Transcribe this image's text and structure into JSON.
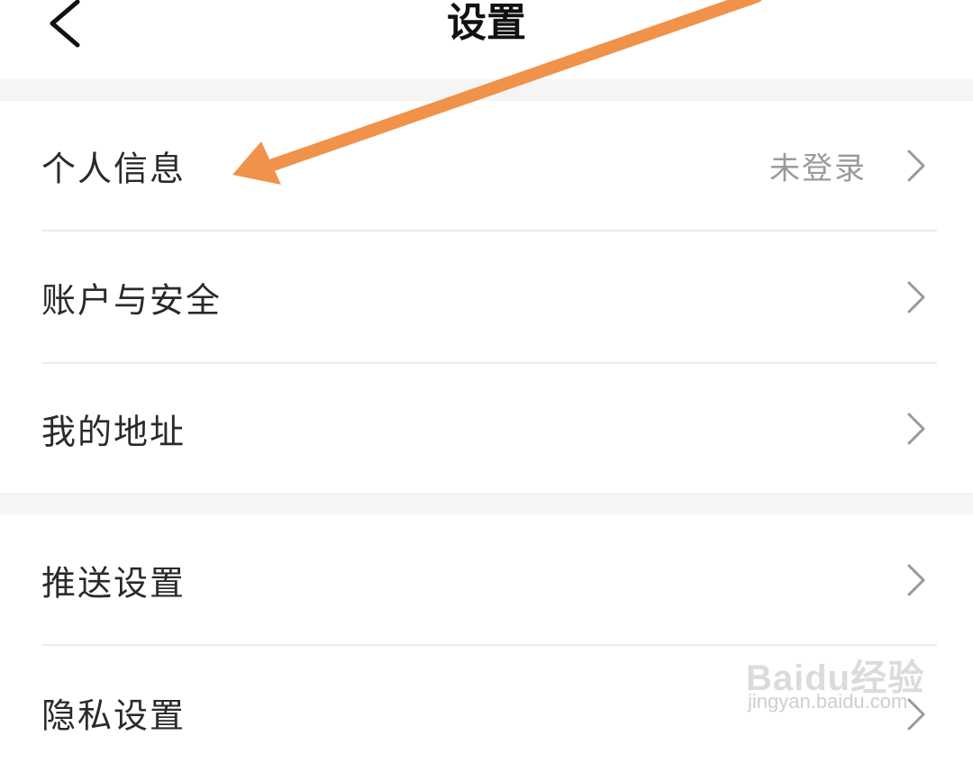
{
  "header": {
    "title": "设置"
  },
  "sections": [
    {
      "items": [
        {
          "label": "个人信息",
          "value": "未登录"
        },
        {
          "label": "账户与安全",
          "value": ""
        },
        {
          "label": "我的地址",
          "value": ""
        }
      ]
    },
    {
      "items": [
        {
          "label": "推送设置",
          "value": ""
        },
        {
          "label": "隐私设置",
          "value": ""
        }
      ]
    }
  ],
  "watermark": {
    "logo": "Baidu经验",
    "url": "jingyan.baidu.com"
  },
  "icons": {
    "back": "chevron-left-icon",
    "row": "chevron-right-icon"
  },
  "colors": {
    "annotation_arrow": "#F0924A",
    "background_gap": "#F5F5F5",
    "value_text": "#9A9A9A"
  }
}
